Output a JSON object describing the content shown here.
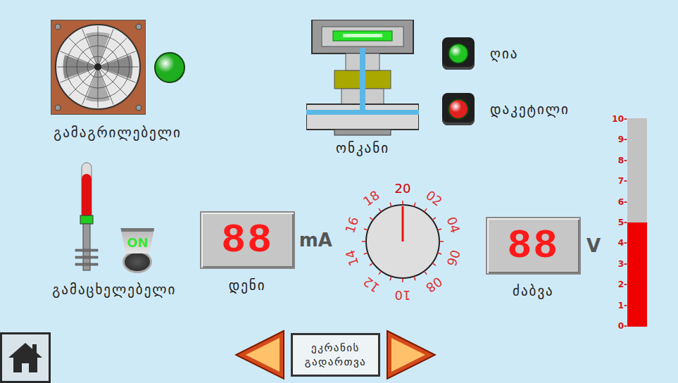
{
  "fan": {
    "label": "გამაგრილებელი",
    "on": true,
    "color": "#1fae1f"
  },
  "valve": {
    "label": "ონკანი",
    "indicators": [
      {
        "label": "ღია",
        "on": true,
        "color": "#22c322"
      },
      {
        "label": "დაკეტილი",
        "on": true,
        "color": "#e02020"
      }
    ]
  },
  "heater": {
    "label": "გამაცხელებელი",
    "level": 0.8,
    "switch": {
      "label": "ON",
      "on": true
    }
  },
  "current": {
    "label": "დენი",
    "reading": "88",
    "unit": "mA"
  },
  "dial": {
    "ticks": [
      {
        "label": "20",
        "selected": true
      },
      {
        "label": "02",
        "selected": false
      },
      {
        "label": "04",
        "selected": false
      },
      {
        "label": "06",
        "selected": false
      },
      {
        "label": "08",
        "selected": false
      },
      {
        "label": "10",
        "selected": false
      },
      {
        "label": "12",
        "selected": false
      },
      {
        "label": "14",
        "selected": false
      },
      {
        "label": "16",
        "selected": false
      },
      {
        "label": "18",
        "selected": false
      }
    ]
  },
  "voltage": {
    "label": "ძაბვა",
    "reading": "88",
    "unit": "V"
  },
  "bar": {
    "ticks": [
      "10-",
      "9-",
      "8-",
      "7-",
      "6-",
      "5-",
      "4-",
      "3-",
      "2-",
      "1-",
      "0-"
    ],
    "level": 0.5
  },
  "nav": {
    "switch_button": {
      "lines": [
        "ეკრანის",
        "გადართვა"
      ]
    }
  }
}
